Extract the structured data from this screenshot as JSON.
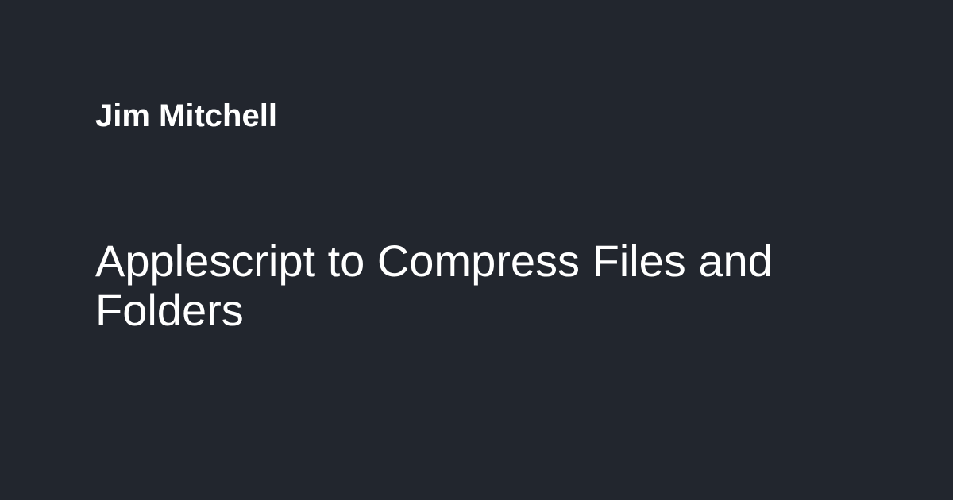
{
  "card": {
    "author": "Jim Mitchell",
    "title": "Applescript to Compress Files and Folders",
    "background_color": "#22262e",
    "text_color": "#ffffff"
  }
}
